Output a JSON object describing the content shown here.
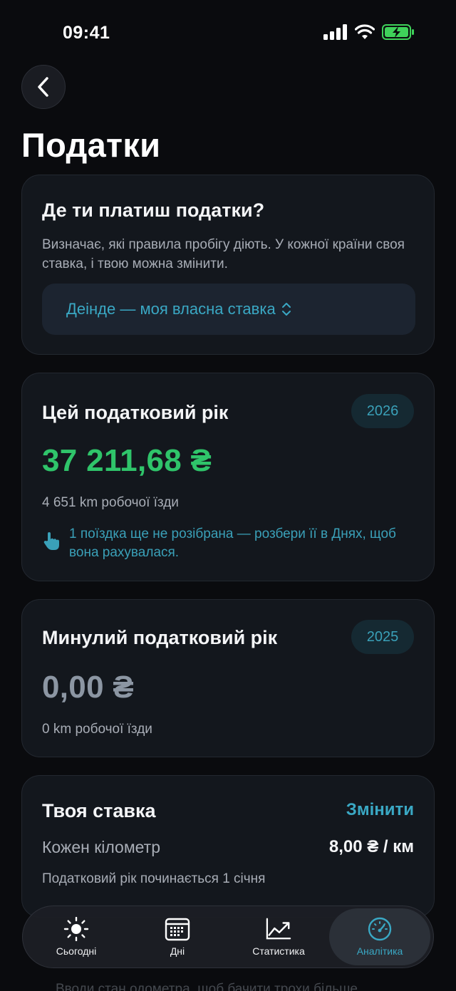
{
  "status": {
    "time": "09:41"
  },
  "page": {
    "title": "Податки"
  },
  "tax_location": {
    "heading": "Де ти платиш податки?",
    "description": "Визначає, які правила пробігу діють. У кожної країни своя ставка, і твою можна змінити.",
    "selected": "Деінде — моя власна ставка"
  },
  "current_year": {
    "heading": "Цей податковий рік",
    "year": "2026",
    "amount": "37 211,68 ₴",
    "km": "4 651 km робочої їзди",
    "hint": "1 поїздка ще не розібрана — розбери її в Днях, щоб вона рахувалася."
  },
  "previous_year": {
    "heading": "Минулий податковий рік",
    "year": "2025",
    "amount": "0,00 ₴",
    "km": "0 km робочої їзди"
  },
  "rate": {
    "heading": "Твоя ставка",
    "change_label": "Змінити",
    "per_km_label": "Кожен кілометр",
    "per_km_value": "8,00 ₴ / км",
    "note": "Податковий рік починається 1 січня"
  },
  "under_text": "Вводи стан одометра, щоб бачити трохи більше",
  "tabs": [
    {
      "label": "Сьогодні",
      "icon": "sun-icon"
    },
    {
      "label": "Дні",
      "icon": "calendar-icon"
    },
    {
      "label": "Статистика",
      "icon": "chart-icon"
    },
    {
      "label": "Аналітика",
      "icon": "gauge-icon"
    }
  ],
  "colors": {
    "accent": "#3aa8c4",
    "positive": "#2fc46a",
    "battery": "#3fd25a",
    "background": "#0a0b0e"
  }
}
